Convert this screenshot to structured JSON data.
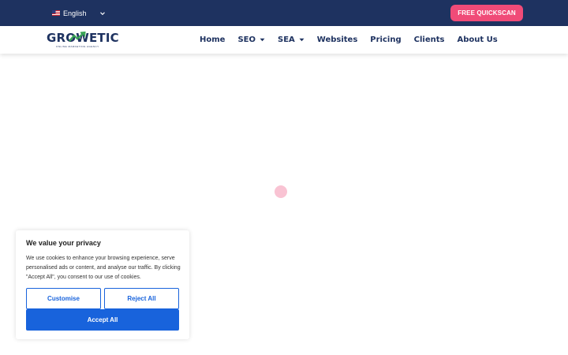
{
  "topbar": {
    "language": "English",
    "quickscan_label": "FREE QUICKSCAN"
  },
  "navbar": {
    "logo_text": "GROWETIC",
    "logo_tagline": "ONLINE MARKETING AGENCY",
    "menu": [
      {
        "label": "Home",
        "has_dropdown": false
      },
      {
        "label": "SEO",
        "has_dropdown": true
      },
      {
        "label": "SEA",
        "has_dropdown": true
      },
      {
        "label": "Websites",
        "has_dropdown": false
      },
      {
        "label": "Pricing",
        "has_dropdown": false
      },
      {
        "label": "Clients",
        "has_dropdown": false
      },
      {
        "label": "About Us",
        "has_dropdown": false
      }
    ]
  },
  "cookie_banner": {
    "title": "We value your privacy",
    "body": "We use cookies to enhance your browsing experience, serve personalised ads or content, and analyse our traffic. By clicking \"Accept All\", you consent to our use of cookies.",
    "customise_label": "Customise",
    "reject_label": "Reject All",
    "accept_label": "Accept All"
  },
  "icons": {
    "flag": "us-flag-icon",
    "language_chevron": "chevron-down-icon",
    "menu_caret": "caret-down-icon",
    "loader": "loading-spinner-icon"
  },
  "colors": {
    "topbar_bg": "#1e3260",
    "brand_navy": "#1e3260",
    "quickscan_pink": "#f04b78",
    "loader_pink": "#f9c3d3",
    "cookie_blue": "#1863dc",
    "logo_green": "#3aa655"
  }
}
